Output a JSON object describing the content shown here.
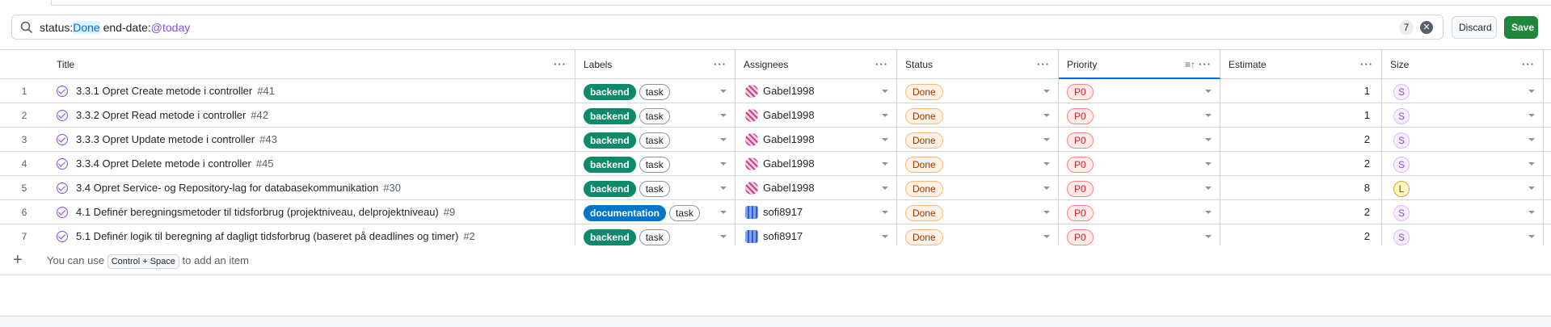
{
  "filter": {
    "query_parts": [
      {
        "text": "status:",
        "kind": "key"
      },
      {
        "text": "Done",
        "kind": "value-done"
      },
      {
        "text": " end-date:",
        "kind": "key"
      },
      {
        "text": "@today",
        "kind": "value-today"
      }
    ],
    "result_count": "7",
    "clear_icon": "x-circle-icon",
    "search_icon": "search-icon"
  },
  "buttons": {
    "discard": "Discard",
    "save": "Save"
  },
  "columns": [
    "Title",
    "Labels",
    "Assignees",
    "Status",
    "Priority",
    "Estimate",
    "Size"
  ],
  "rows": [
    {
      "n": "1",
      "title": "3.3.1 Opret Create metode i controller",
      "num": "#41",
      "labels": [
        "backend",
        "task"
      ],
      "assignee": "Gabel1998",
      "avatar": "gabel",
      "status": "Done",
      "priority": "P0",
      "estimate": "1",
      "size": "S"
    },
    {
      "n": "2",
      "title": "3.3.2 Opret Read metode i controller",
      "num": "#42",
      "labels": [
        "backend",
        "task"
      ],
      "assignee": "Gabel1998",
      "avatar": "gabel",
      "status": "Done",
      "priority": "P0",
      "estimate": "1",
      "size": "S"
    },
    {
      "n": "3",
      "title": "3.3.3 Opret Update metode i controller",
      "num": "#43",
      "labels": [
        "backend",
        "task"
      ],
      "assignee": "Gabel1998",
      "avatar": "gabel",
      "status": "Done",
      "priority": "P0",
      "estimate": "2",
      "size": "S"
    },
    {
      "n": "4",
      "title": "3.3.4 Opret Delete metode i controller",
      "num": "#45",
      "labels": [
        "backend",
        "task"
      ],
      "assignee": "Gabel1998",
      "avatar": "gabel",
      "status": "Done",
      "priority": "P0",
      "estimate": "2",
      "size": "S"
    },
    {
      "n": "5",
      "title": "3.4 Opret Service- og Repository-lag for databasekommunikation",
      "num": "#30",
      "labels": [
        "backend",
        "task"
      ],
      "assignee": "Gabel1998",
      "avatar": "gabel",
      "status": "Done",
      "priority": "P0",
      "estimate": "8",
      "size": "L"
    },
    {
      "n": "6",
      "title": "4.1 Definér beregningsmetoder til tidsforbrug (projektniveau, delprojektniveau)",
      "num": "#9",
      "labels": [
        "documentation",
        "task"
      ],
      "assignee": "sofi8917",
      "avatar": "sofi",
      "status": "Done",
      "priority": "P0",
      "estimate": "2",
      "size": "S"
    },
    {
      "n": "7",
      "title": "5.1 Definér logik til beregning af dagligt tidsforbrug (baseret på deadlines og timer)",
      "num": "#2",
      "labels": [
        "backend",
        "task"
      ],
      "assignee": "sofi8917",
      "avatar": "sofi",
      "status": "Done",
      "priority": "P0",
      "estimate": "2",
      "size": "S"
    }
  ],
  "add_item": {
    "hint_before": "You can use",
    "shortcut": "Control + Space",
    "hint_after": "to add an item"
  },
  "colors": {
    "accent": "#0969da",
    "save": "#1f883d",
    "backend": "#0e8a6a",
    "documentation": "#0075ca",
    "done": "#953800",
    "p0": "#cf222e",
    "size_s": "#8250df"
  }
}
